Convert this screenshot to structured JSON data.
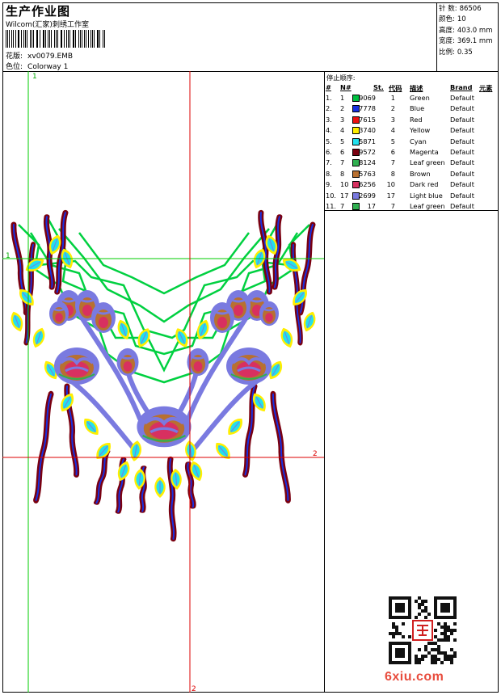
{
  "header": {
    "title": "生产作业图",
    "company": "Wilcom(汇家)刺绣工作室",
    "design_label": "花版:",
    "design_value": "xv0079.EMB",
    "colorway_label": "色位:",
    "colorway_value": "Colorway 1"
  },
  "stats": [
    {
      "label": "针 数:",
      "value": "86506"
    },
    {
      "label": "颜色:",
      "value": "10"
    },
    {
      "label": "高度:",
      "value": "403.0 mm"
    },
    {
      "label": "宽度:",
      "value": "369.1 mm"
    },
    {
      "label": "比例:",
      "value": "0.35"
    }
  ],
  "guides": {
    "top_label": "1",
    "left_label": "1",
    "right_label": "2",
    "bottom_label": "2"
  },
  "color_table": {
    "title": "停止顺序:",
    "headers": {
      "num": "#",
      "needle": "N#",
      "stitches": "St.",
      "code": "代码",
      "desc": "描述",
      "brand": "Brand",
      "element": "元素"
    },
    "rows": [
      {
        "num": "1.",
        "needle": "1",
        "color": "#00c040",
        "stitches": "9069",
        "code": "1",
        "desc": "Green",
        "brand": "Default"
      },
      {
        "num": "2.",
        "needle": "2",
        "color": "#1830e0",
        "stitches": "7778",
        "code": "2",
        "desc": "Blue",
        "brand": "Default"
      },
      {
        "num": "3.",
        "needle": "3",
        "color": "#ee1111",
        "stitches": "7615",
        "code": "3",
        "desc": "Red",
        "brand": "Default"
      },
      {
        "num": "4.",
        "needle": "4",
        "color": "#ffee00",
        "stitches": "13740",
        "code": "4",
        "desc": "Yellow",
        "brand": "Default"
      },
      {
        "num": "5.",
        "needle": "5",
        "color": "#22e0ee",
        "stitches": "5871",
        "code": "5",
        "desc": "Cyan",
        "brand": "Default"
      },
      {
        "num": "6.",
        "needle": "6",
        "color": "#7a0010",
        "stitches": "9572",
        "code": "6",
        "desc": "Magenta",
        "brand": "Default"
      },
      {
        "num": "7.",
        "needle": "7",
        "color": "#30b050",
        "stitches": "8124",
        "code": "7",
        "desc": "Leaf green",
        "brand": "Default"
      },
      {
        "num": "8.",
        "needle": "8",
        "color": "#b87030",
        "stitches": "5763",
        "code": "8",
        "desc": "Brown",
        "brand": "Default"
      },
      {
        "num": "9.",
        "needle": "10",
        "color": "#d83060",
        "stitches": "6256",
        "code": "10",
        "desc": "Dark red",
        "brand": "Default"
      },
      {
        "num": "10.",
        "needle": "17",
        "color": "#7a7ae0",
        "stitches": "12699",
        "code": "17",
        "desc": "Light blue",
        "brand": "Default"
      },
      {
        "num": "11.",
        "needle": "7",
        "color": "#30b050",
        "stitches": "17",
        "code": "7",
        "desc": "Leaf green",
        "brand": "Default"
      }
    ]
  },
  "watermark": {
    "site": "6xiu.com",
    "seal_icon": "red-seal-icon"
  }
}
